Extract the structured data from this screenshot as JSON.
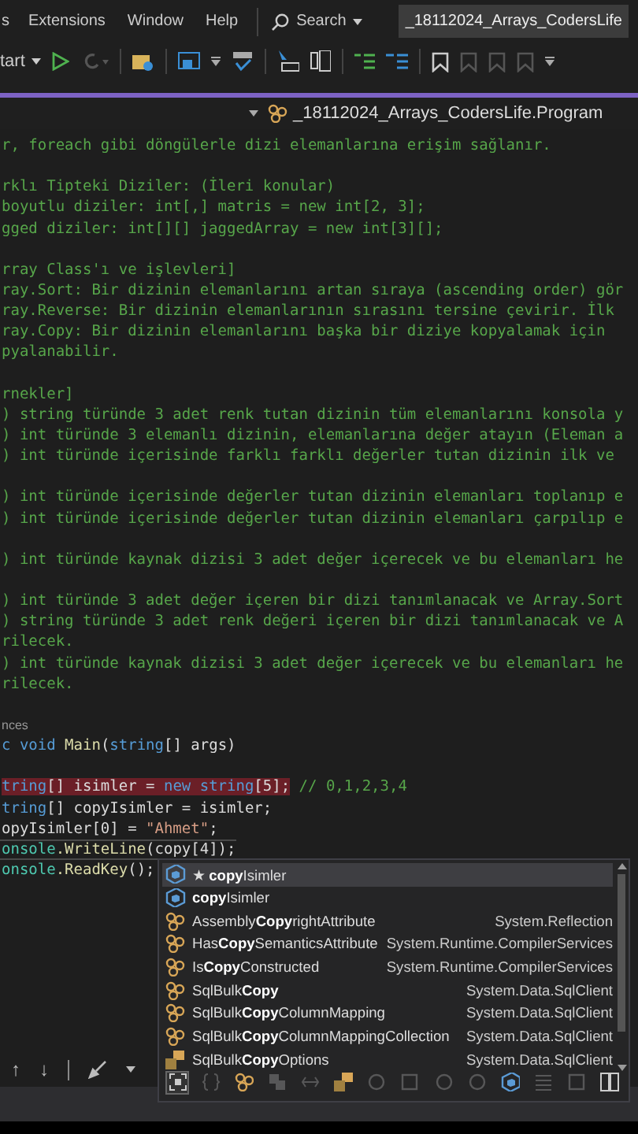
{
  "menu": [
    "s",
    "Extensions",
    "Window",
    "Help"
  ],
  "search": {
    "label": "Search"
  },
  "window": {
    "title": "_18112024_Arrays_CodersLife"
  },
  "toolbar": {
    "start_label": "tart"
  },
  "navigation": {
    "class_path": "_18112024_Arrays_CodersLife.Program"
  },
  "code_lines": [
    {
      "kind": "comment",
      "text": "r, foreach gibi döngülerle dizi elemanlarına erişim sağlanır."
    },
    {
      "kind": "blank"
    },
    {
      "kind": "comment",
      "text": "rklı Tipteki Diziler: (İleri konular)"
    },
    {
      "kind": "comment",
      "text": "boyutlu diziler: int[,] matris = new int[2, 3];"
    },
    {
      "kind": "comment",
      "text": "gged diziler: int[][] jaggedArray = new int[3][];"
    },
    {
      "kind": "blank"
    },
    {
      "kind": "comment",
      "text": "rray Class'ı ve işlevleri]"
    },
    {
      "kind": "comment",
      "text": "ray.Sort: Bir dizinin elemanlarını artan sıraya (ascending order) gör"
    },
    {
      "kind": "comment",
      "text": "ray.Reverse: Bir dizinin elemanlarının sırasını tersine çevirir. İlk"
    },
    {
      "kind": "comment",
      "text": "ray.Copy: Bir dizinin elemanlarını başka bir diziye kopyalamak için"
    },
    {
      "kind": "comment",
      "text": "pyalanabilir."
    },
    {
      "kind": "blank"
    },
    {
      "kind": "comment",
      "text": "rnekler]"
    },
    {
      "kind": "comment",
      "text": ") string türünde 3 adet renk tutan dizinin tüm elemanlarını konsola y"
    },
    {
      "kind": "comment",
      "text": ") int türünde 3 elemanlı dizinin, elemanlarına değer atayın (Eleman a"
    },
    {
      "kind": "comment",
      "text": ") int türünde içerisinde farklı farklı değerler tutan dizinin ilk ve"
    },
    {
      "kind": "blank"
    },
    {
      "kind": "comment",
      "text": ") int türünde içerisinde değerler tutan dizinin elemanları toplanıp e"
    },
    {
      "kind": "comment",
      "text": ") int türünde içerisinde değerler tutan dizinin elemanları çarpılıp e"
    },
    {
      "kind": "blank"
    },
    {
      "kind": "comment",
      "text": ") int türünde kaynak dizisi 3 adet değer içerecek ve bu elemanları he"
    },
    {
      "kind": "blank"
    },
    {
      "kind": "comment",
      "text": ") int türünde 3 adet değer içeren bir dizi tanımlanacak ve Array.Sort"
    },
    {
      "kind": "comment",
      "text": ") string türünde 3 adet renk değeri içeren bir dizi tanımlanacak ve A"
    },
    {
      "kind": "comment",
      "text": "rilecek."
    },
    {
      "kind": "comment",
      "text": ") int türünde kaynak dizisi 3 adet değer içerecek ve bu elemanları he"
    },
    {
      "kind": "comment",
      "text": "rilecek."
    },
    {
      "kind": "blank"
    },
    {
      "kind": "codelens",
      "text": "nces"
    },
    {
      "kind": "code",
      "current": false,
      "tokens": [
        {
          "t": "c void",
          "kind": "keyword"
        },
        {
          "t": " Main",
          "kind": "method"
        },
        {
          "t": "(",
          "kind": "plain"
        },
        {
          "t": "string",
          "kind": "keyword"
        },
        {
          "t": "[] args)",
          "kind": "plain"
        }
      ]
    },
    {
      "kind": "blank"
    },
    {
      "kind": "code",
      "current": false,
      "tokens": [
        {
          "t": "tring",
          "kind": "keyword",
          "flagged": true
        },
        {
          "t": "[] isimler = ",
          "kind": "plain",
          "flagged": true
        },
        {
          "t": "new string",
          "kind": "keyword",
          "flagged": true
        },
        {
          "t": "[5];",
          "kind": "plain",
          "flagged": true
        },
        {
          "t": " // 0,1,2,3,4",
          "kind": "comment",
          "flagged": false
        }
      ]
    },
    {
      "kind": "code",
      "current": false,
      "tokens": [
        {
          "t": "tring",
          "kind": "keyword"
        },
        {
          "t": "[] copyIsimler = isimler;",
          "kind": "plain"
        }
      ]
    },
    {
      "kind": "code",
      "current": false,
      "tokens": [
        {
          "t": "opyIsimler[0] = ",
          "kind": "plain"
        },
        {
          "t": "\"Ahmet\"",
          "kind": "string"
        },
        {
          "t": ";",
          "kind": "plain"
        }
      ]
    },
    {
      "kind": "code",
      "current": true,
      "tokens": [
        {
          "t": "onsole",
          "kind": "type"
        },
        {
          "t": ".WriteLine",
          "kind": "method"
        },
        {
          "t": "(copy[4]);",
          "kind": "plain"
        }
      ]
    },
    {
      "kind": "code",
      "current": false,
      "tokens": [
        {
          "t": "onsole",
          "kind": "type"
        },
        {
          "t": ".ReadKey",
          "kind": "method"
        },
        {
          "t": "();",
          "kind": "plain"
        }
      ]
    }
  ],
  "completion": {
    "items": [
      {
        "kind": "field",
        "label": "★ **copy**Isimler",
        "selected": true
      },
      {
        "kind": "field",
        "label": "**copy**Isimler",
        "selected": false
      },
      {
        "kind": "class",
        "label": "Assembly**Copy**rightAttribute",
        "namespace": "System.Reflection",
        "selected": false
      },
      {
        "kind": "class",
        "label": "Has**Copy**SemanticsAttribute",
        "namespace": "System.Runtime.CompilerServices",
        "selected": false
      },
      {
        "kind": "class",
        "label": "Is**Copy**Constructed",
        "namespace": "System.Runtime.CompilerServices",
        "selected": false
      },
      {
        "kind": "class",
        "label": "SqlBulk**Copy**",
        "namespace": "System.Data.SqlClient",
        "selected": false
      },
      {
        "kind": "class",
        "label": "SqlBulk**Copy**ColumnMapping",
        "namespace": "System.Data.SqlClient",
        "selected": false
      },
      {
        "kind": "class",
        "label": "SqlBulk**Copy**ColumnMappingCollection",
        "namespace": "System.Data.SqlClient",
        "selected": false
      },
      {
        "kind": "enum",
        "label": "SqlBulk**Copy**Options",
        "namespace": "System.Data.SqlClient",
        "selected": false
      }
    ],
    "filters": [
      {
        "kind": "snippet",
        "selected": true,
        "enabled": true
      },
      {
        "kind": "braces",
        "selected": false,
        "enabled": false
      },
      {
        "kind": "class",
        "selected": false,
        "enabled": true
      },
      {
        "kind": "module",
        "selected": false,
        "enabled": false
      },
      {
        "kind": "link",
        "selected": false,
        "enabled": false
      },
      {
        "kind": "enum",
        "selected": false,
        "enabled": true
      },
      {
        "kind": "circle",
        "selected": false,
        "enabled": false
      },
      {
        "kind": "square",
        "selected": false,
        "enabled": false
      },
      {
        "kind": "circle",
        "selected": false,
        "enabled": false
      },
      {
        "kind": "circle",
        "selected": false,
        "enabled": false
      },
      {
        "kind": "field",
        "selected": false,
        "enabled": true
      },
      {
        "kind": "lines",
        "selected": false,
        "enabled": false
      },
      {
        "kind": "square",
        "selected": false,
        "enabled": false
      },
      {
        "kind": "split",
        "selected": false,
        "enabled": true
      }
    ]
  },
  "bottom_toolbar": {
    "up": "↑",
    "down": "↓"
  }
}
